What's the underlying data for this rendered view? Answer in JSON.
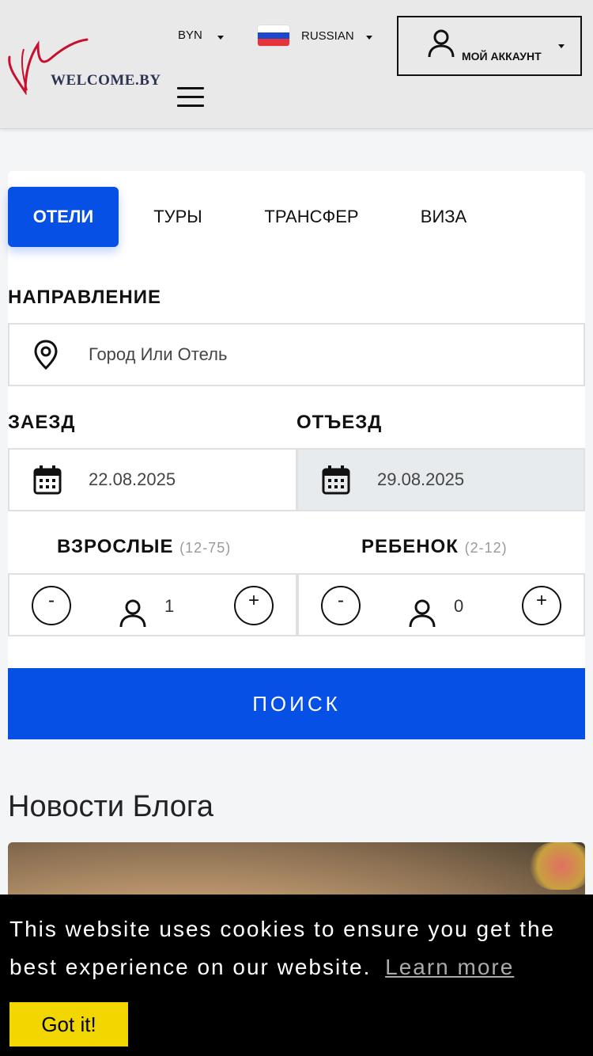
{
  "header": {
    "logo_text": "WELCOME.BY",
    "currency": "BYN",
    "language": "RUSSIAN",
    "account_label": "МОЙ АККАУНТ"
  },
  "tabs": [
    {
      "label": "ОТЕЛИ",
      "active": true
    },
    {
      "label": "ТУРЫ",
      "active": false
    },
    {
      "label": "ТРАНСФЕР",
      "active": false
    },
    {
      "label": "ВИЗА",
      "active": false
    }
  ],
  "search": {
    "destination_label": "НАПРАВЛЕНИЕ",
    "destination_placeholder": "Город Или Отель",
    "checkin_label": "ЗАЕЗД",
    "checkin_value": "22.08.2025",
    "checkout_label": "ОТЪЕЗД",
    "checkout_value": "29.08.2025",
    "adults_label": "ВЗРОСЛЫЕ",
    "adults_range": "(12-75)",
    "adults_value": "1",
    "children_label": "РЕБЕНОК",
    "children_range": "(2-12)",
    "children_value": "0",
    "minus": "-",
    "plus": "+",
    "submit_label": "ПОИСК"
  },
  "blog": {
    "title": "Новости Блога"
  },
  "cookie": {
    "message": "This website uses cookies to ensure you get the best experience on our website.",
    "learn_more": "Learn more",
    "accept": "Got it!"
  },
  "colors": {
    "accent": "#0750e6",
    "cookie_button": "#f1d600",
    "header_bg": "#e9e9ea"
  }
}
